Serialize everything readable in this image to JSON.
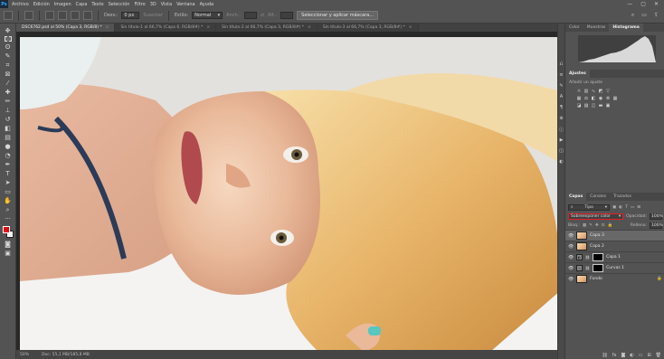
{
  "app": {
    "logo": "Ps",
    "menu": [
      "Archivo",
      "Edición",
      "Imagen",
      "Capa",
      "Texto",
      "Selección",
      "Filtro",
      "3D",
      "Vista",
      "Ventana",
      "Ayuda"
    ],
    "window_controls": [
      "—",
      "▢",
      "✕"
    ]
  },
  "options_bar": {
    "fade_label": "Desv.:",
    "fade_value": "0 px",
    "smooth_label": "Suavizar",
    "style_label": "Estilo:",
    "style_value": "Normal",
    "width_label": "Anch.:",
    "height_label": "Alt.:",
    "select_mask_button": "Seleccionar y aplicar máscara..."
  },
  "tabs": [
    {
      "label": "DSC6762.psd al 50% (Capa 3, RGB/8) *",
      "active": true
    },
    {
      "label": "Sin título-1 al 66,7% (Capa 6, RGB/8#) *",
      "active": false
    },
    {
      "label": "Sin título-2 al 66,7% (Capa 3, RGB/8#) *",
      "active": false
    },
    {
      "label": "Sin título-3 al 66,7% (Capa 3, RGB/8#) *",
      "active": false
    }
  ],
  "status_bar": {
    "zoom": "50%",
    "doc_info": "Doc: 55,1 MB/185,8 MB"
  },
  "panels": {
    "histogram_tabs": [
      "Color",
      "Muestras",
      "Histograma"
    ],
    "adjustments_tab": "Ajustes",
    "adjustments_subtitle": "Añadir un ajuste",
    "layers_tabs": [
      "Capas",
      "Canales",
      "Trazados"
    ],
    "filter_kind": "Tipo",
    "blend_mode": "Sobreexponer color",
    "opacity_label": "Opacidad:",
    "opacity_value": "100%",
    "lock_label": "Bloq.:",
    "fill_label": "Relleno:",
    "fill_value": "100%",
    "layers": [
      {
        "name": "Capa 3",
        "type": "pixel",
        "selected": true,
        "visible": true
      },
      {
        "name": "Capa 2",
        "type": "pixel",
        "selected": false,
        "visible": true
      },
      {
        "name": "Capa 1",
        "type": "adjustment",
        "selected": false,
        "visible": true
      },
      {
        "name": "Curvas 1",
        "type": "adjustment",
        "selected": false,
        "visible": true
      },
      {
        "name": "Fondo",
        "type": "background",
        "selected": false,
        "visible": true
      }
    ]
  },
  "colors": {
    "foreground": "#e30613",
    "background": "#ffffff",
    "highlight": "#e11f26"
  }
}
